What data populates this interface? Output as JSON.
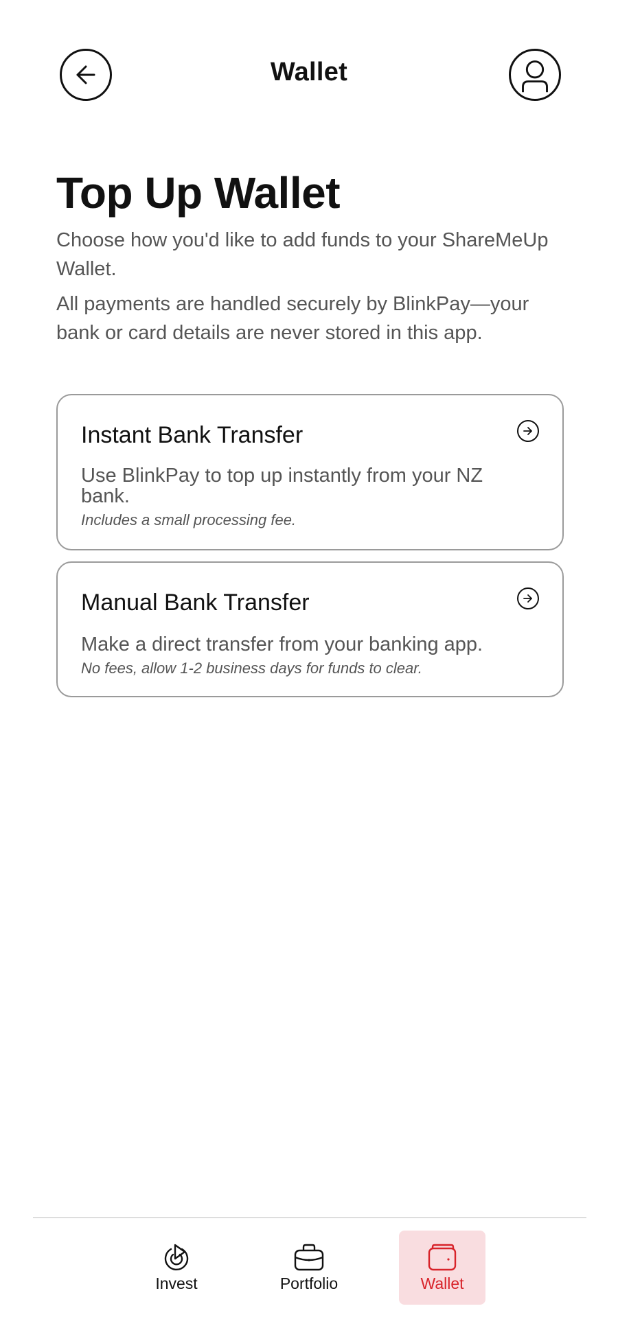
{
  "header": {
    "title": "Wallet",
    "back_icon": "arrow-left-icon",
    "profile_icon": "user-circle-icon"
  },
  "intro": {
    "title": "Top Up Wallet",
    "paragraph_1": "Choose how you'd like to add funds to your ShareMeUp Wallet.",
    "paragraph_2": "All payments are handled securely by BlinkPay—your bank or card details are never stored in this app."
  },
  "options": [
    {
      "title": "Instant Bank Transfer",
      "description": "Use BlinkPay to top up instantly from your NZ bank.",
      "note": "Includes a small processing fee.",
      "icon": "arrow-right-circle-icon"
    },
    {
      "title": "Manual Bank Transfer",
      "description": "Make a direct transfer from your banking app.",
      "note": "No fees, allow 1-2 business days for funds to clear.",
      "icon": "arrow-right-circle-icon"
    }
  ],
  "nav": {
    "items": [
      {
        "label": "Invest",
        "icon": "invest-icon",
        "active": false
      },
      {
        "label": "Portfolio",
        "icon": "briefcase-icon",
        "active": false
      },
      {
        "label": "Wallet",
        "icon": "wallet-icon",
        "active": true
      }
    ]
  },
  "colors": {
    "accent": "#d8232a",
    "active_nav_bg": "#f9dde0",
    "text_primary": "#111111",
    "text_secondary": "#555555",
    "card_border": "#9a9a9a"
  }
}
